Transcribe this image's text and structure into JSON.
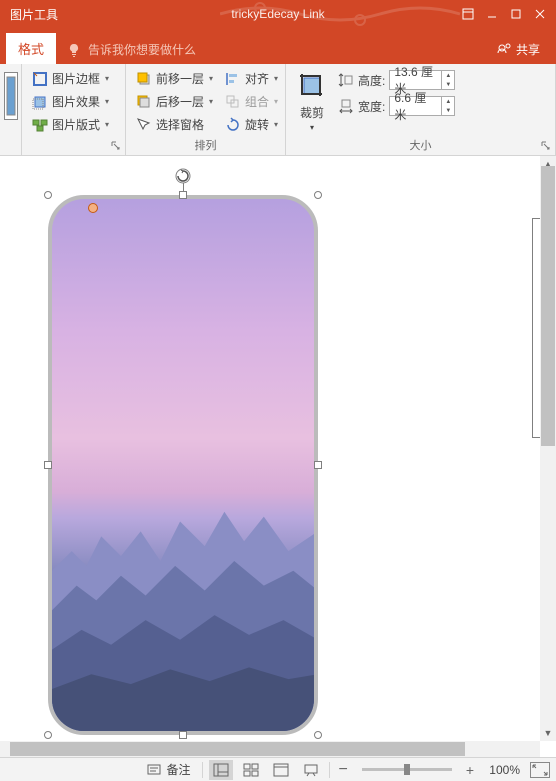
{
  "titlebar": {
    "tool_context": "图片工具",
    "title": "trickyEdecay Link"
  },
  "tabs": {
    "format": "格式",
    "tellme": "告诉我你想要做什么",
    "share": "共享"
  },
  "ribbon": {
    "picture_border": "图片边框",
    "picture_effects": "图片效果",
    "picture_layout": "图片版式",
    "bring_forward": "前移一层",
    "send_backward": "后移一层",
    "selection_pane": "选择窗格",
    "align": "对齐",
    "group": "组合",
    "rotate": "旋转",
    "arrange_label": "排列",
    "crop": "裁剪",
    "height_label": "高度:",
    "width_label": "宽度:",
    "height_value": "13.6 厘米",
    "width_value": "6.6 厘米",
    "size_label": "大小"
  },
  "statusbar": {
    "notes": "备注",
    "zoom": "100%"
  }
}
